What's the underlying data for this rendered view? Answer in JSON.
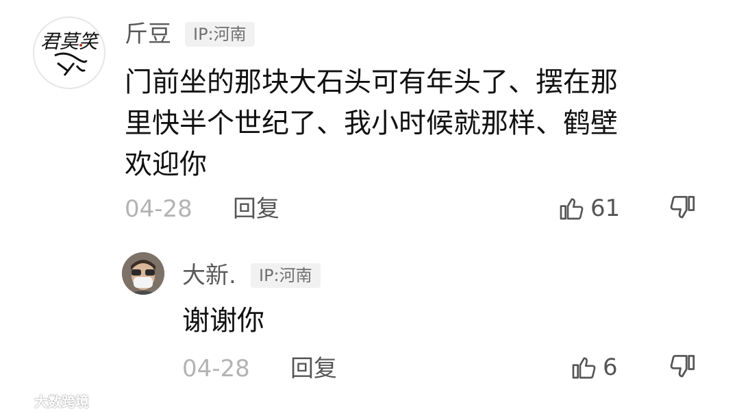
{
  "comments": [
    {
      "username": "斤豆",
      "ip": "IP:河南",
      "text_lines": [
        "门前坐的那块大石头可有年头了、摆在那",
        "里快半个世纪了、我小时候就那样、鹤壁",
        "欢迎你"
      ],
      "date": "04-28",
      "reply_label": "回复",
      "likes": "61",
      "avatar_icon": "calligraphy-logo-avatar",
      "avatar_text": "君莫笑"
    },
    {
      "username": "大新.",
      "ip": "IP:河南",
      "text": "谢谢你",
      "date": "04-28",
      "reply_label": "回复",
      "likes": "6",
      "avatar_icon": "masked-man-avatar"
    }
  ],
  "watermark": {
    "text": "大数跨境"
  },
  "colors": {
    "username": "#595959",
    "badge_bg": "#f1f1f1",
    "date": "#b3b3b3",
    "action": "#555555"
  }
}
